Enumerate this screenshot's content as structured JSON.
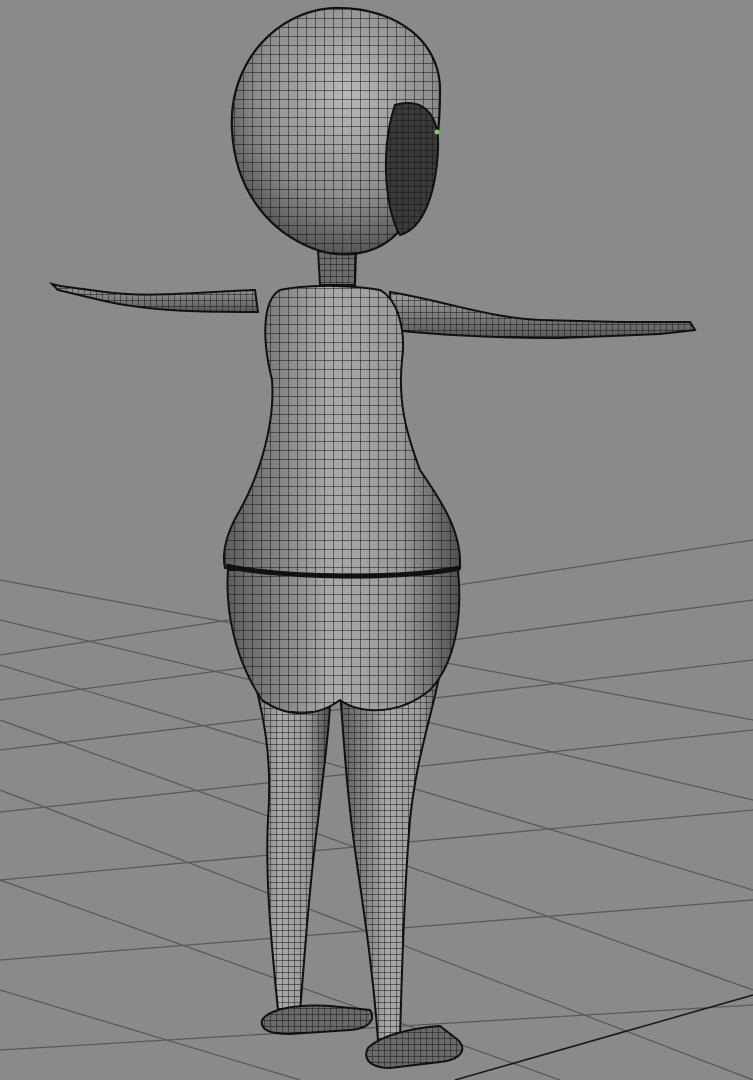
{
  "viewport": {
    "background_color": "#8a8a8a",
    "grid_color": "#5a5a5a",
    "wireframe_color": "#111111",
    "mesh_fill": "#8c8c8c",
    "selection_highlight_color": "#7fd14a",
    "display_mode": "wireframe-on-shaded",
    "grid_visible": true,
    "camera": "perspective"
  },
  "model": {
    "pose": "T-pose",
    "parts": [
      "head",
      "neck",
      "left-arm",
      "right-arm",
      "torso",
      "pelvis",
      "left-leg",
      "right-leg",
      "left-foot",
      "right-foot"
    ]
  }
}
